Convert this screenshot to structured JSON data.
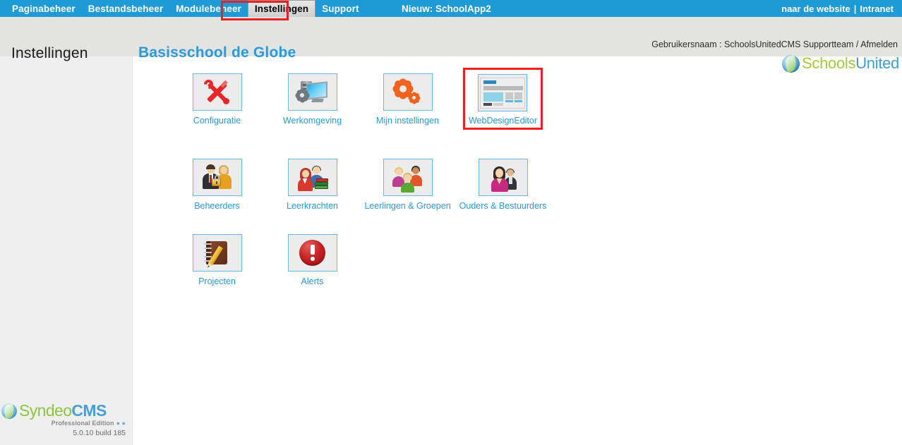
{
  "topnav": {
    "items": [
      {
        "label": "Paginabeheer",
        "active": false
      },
      {
        "label": "Bestandsbeheer",
        "active": false
      },
      {
        "label": "Modulebeheer",
        "active": false
      },
      {
        "label": "Instellingen",
        "active": true
      },
      {
        "label": "Support",
        "active": false
      }
    ],
    "promo": "Nieuw: SchoolApp2",
    "right": {
      "website_link": "naar de website",
      "separator": "|",
      "intranet_link": "Intranet"
    },
    "highlight_color": "#ef2020",
    "bar_color": "#1e9ad6"
  },
  "header": {
    "section_title": "Instellingen",
    "school_name": "Basisschool de Globe",
    "user_line": "Gebruikersnaam : SchoolsUnitedCMS Supportteam / Afmelden",
    "logo": {
      "part1": "Schools",
      "part2": "United",
      "part1_color": "#a3cb38",
      "part2_color": "#3a9fd6"
    }
  },
  "sidebar": {
    "branding": {
      "name_part1": "Syndeo",
      "name_part2": "CMS",
      "edition": "Professional Edition",
      "dots": "● ●",
      "version": "5.0.10 build 185",
      "part1_color": "#8cc63f",
      "part2_color": "#4a9fd5"
    }
  },
  "main": {
    "rows": [
      [
        {
          "label": "Configuratie",
          "icon": "tools-icon",
          "selected": false
        },
        {
          "label": "Werkomgeving",
          "icon": "workstation-icon",
          "selected": false
        },
        {
          "label": "Mijn instellingen",
          "icon": "gears-icon",
          "selected": false
        },
        {
          "label": "WebDesignEditor",
          "icon": "webpage-layout-icon",
          "selected": true
        }
      ],
      [
        {
          "label": "Beheerders",
          "icon": "admins-lock-icon",
          "selected": false
        },
        {
          "label": "Leerkrachten",
          "icon": "teachers-books-icon",
          "selected": false
        },
        {
          "label": "Leerlingen & Groepen",
          "icon": "students-group-icon",
          "selected": false
        },
        {
          "label": "Ouders & Bestuurders",
          "icon": "parents-board-icon",
          "selected": false
        }
      ],
      [
        {
          "label": "Projecten",
          "icon": "notebook-pencil-icon",
          "selected": false
        },
        {
          "label": "Alerts",
          "icon": "alert-exclamation-icon",
          "selected": false
        }
      ]
    ]
  },
  "colors": {
    "link_blue": "#2b9ad8",
    "topbar_blue": "#1e9ad6",
    "header_gray": "#e3e4e1",
    "sidebar_gray": "#efefef",
    "selection_red": "#ef2020"
  }
}
